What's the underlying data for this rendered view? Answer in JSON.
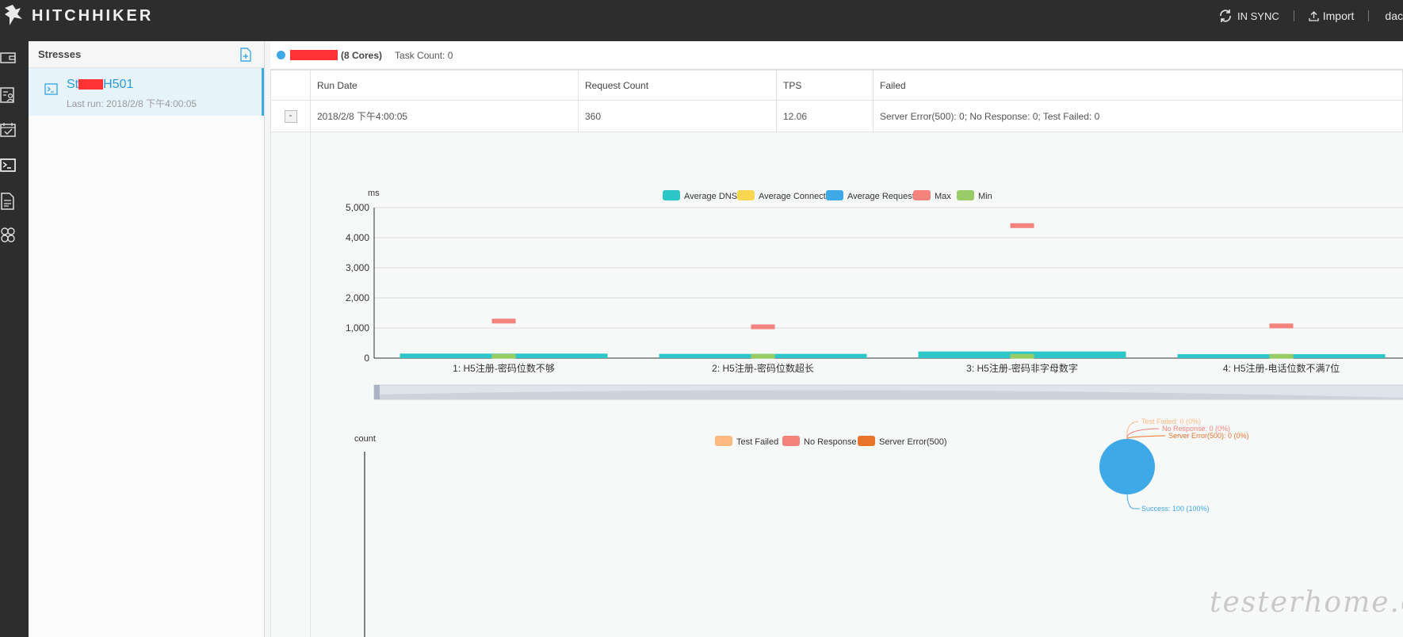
{
  "app": {
    "logo_text": "HITCHHIKER",
    "sync_label": "IN SYNC",
    "import_label": "Import",
    "user_label": "dac"
  },
  "nav_icons": [
    "wallet-icon",
    "contacts-icon",
    "calendar-check-icon",
    "terminal-icon",
    "document-icon",
    "hexagons-icon"
  ],
  "sidebar": {
    "title": "Stresses",
    "items": [
      {
        "name_prefix": "St",
        "name_suffix": "H501",
        "last_run": "Last run: 2018/2/8 下午4:00:05"
      }
    ]
  },
  "main": {
    "cores_label": "(8 Cores)",
    "task_count": "Task Count: 0",
    "table": {
      "headers": [
        "Run Date",
        "Request Count",
        "TPS",
        "Failed"
      ],
      "rows": [
        {
          "toggle": "-",
          "run_date": "2018/2/8 下午4:00:05",
          "request_count": "360",
          "tps": "12.06",
          "failed": "Server Error(500): 0; No Response: 0; Test Failed: 0"
        }
      ]
    }
  },
  "chart_data": [
    {
      "type": "bar",
      "ylabel": "ms",
      "categories": [
        "1: H5注册-密码位数不够",
        "2: H5注册-密码位数超长",
        "3: H5注册-密码非字母数字",
        "4: H5注册-电话位数不满7位"
      ],
      "ylim": [
        0,
        5000
      ],
      "yticks": [
        "0",
        "1,000",
        "2,000",
        "3,000",
        "4,000",
        "5,000"
      ],
      "series": [
        {
          "name": "Average DNS",
          "color": "#2ec7c9",
          "values": [
            150,
            140,
            220,
            130
          ]
        },
        {
          "name": "Average Connect",
          "color": "#f9d651",
          "values": [
            0,
            0,
            0,
            0
          ]
        },
        {
          "name": "Average Request",
          "color": "#3fa9e8",
          "values": [
            0,
            0,
            0,
            0
          ]
        },
        {
          "name": "Max",
          "color": "#f4837d",
          "values": [
            1230,
            1040,
            4400,
            1070
          ]
        },
        {
          "name": "Min",
          "color": "#99cc66",
          "values": [
            60,
            60,
            60,
            60
          ]
        }
      ],
      "legend": "top-center"
    },
    {
      "type": "bar",
      "ylabel": "count",
      "series": [
        {
          "name": "Test Failed",
          "color": "#ffb980"
        },
        {
          "name": "No Response",
          "color": "#f4837d"
        },
        {
          "name": "Server Error(500)",
          "color": "#e8742b"
        }
      ],
      "legend": "top-center"
    },
    {
      "type": "pie",
      "slices": [
        {
          "label": "Success: 100 (100%)",
          "value": 100,
          "color": "#3fa9e8"
        },
        {
          "label": "Test Failed: 0 (0%)",
          "value": 0,
          "color": "#ffb980"
        },
        {
          "label": "No Response: 0 (0%)",
          "value": 0,
          "color": "#f4837d"
        },
        {
          "label": "Server Error(500): 0 (0%)",
          "value": 0,
          "color": "#e8742b"
        }
      ]
    }
  ],
  "watermark": "testerhome.com"
}
